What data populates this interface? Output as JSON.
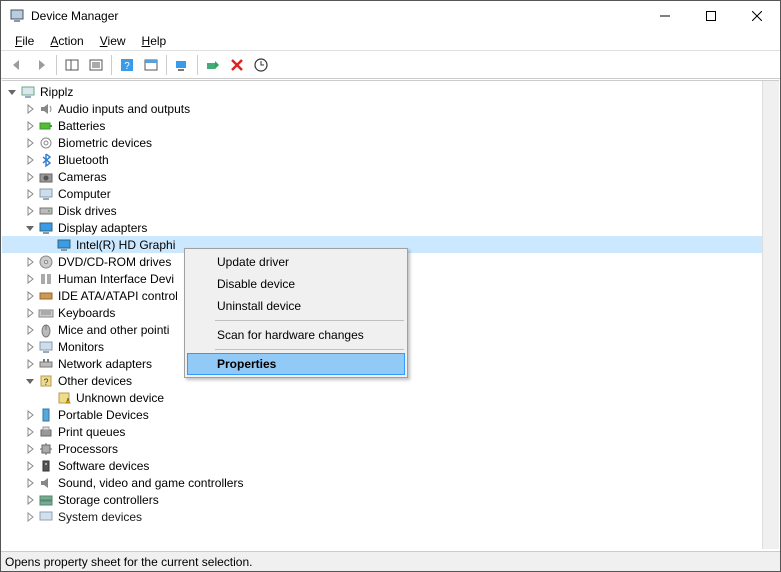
{
  "window": {
    "title": "Device Manager"
  },
  "menu": {
    "file": "File",
    "action": "Action",
    "view": "View",
    "help": "Help"
  },
  "tree": {
    "root": "Ripplz",
    "items": [
      {
        "label": "Audio inputs and outputs"
      },
      {
        "label": "Batteries"
      },
      {
        "label": "Biometric devices"
      },
      {
        "label": "Bluetooth"
      },
      {
        "label": "Cameras"
      },
      {
        "label": "Computer"
      },
      {
        "label": "Disk drives"
      },
      {
        "label": "Display adapters",
        "expanded": true,
        "children": [
          {
            "label": "Intel(R) HD Graphi"
          }
        ]
      },
      {
        "label": "DVD/CD-ROM drives"
      },
      {
        "label": "Human Interface Devi"
      },
      {
        "label": "IDE ATA/ATAPI control"
      },
      {
        "label": "Keyboards"
      },
      {
        "label": "Mice and other pointi"
      },
      {
        "label": "Monitors"
      },
      {
        "label": "Network adapters"
      },
      {
        "label": "Other devices",
        "expanded": true,
        "children": [
          {
            "label": "Unknown device"
          }
        ]
      },
      {
        "label": "Portable Devices"
      },
      {
        "label": "Print queues"
      },
      {
        "label": "Processors"
      },
      {
        "label": "Software devices"
      },
      {
        "label": "Sound, video and game controllers"
      },
      {
        "label": "Storage controllers"
      },
      {
        "label": "System devices"
      }
    ]
  },
  "context_menu": {
    "update": "Update driver",
    "disable": "Disable device",
    "uninstall": "Uninstall device",
    "scan": "Scan for hardware changes",
    "properties": "Properties"
  },
  "status": "Opens property sheet for the current selection."
}
